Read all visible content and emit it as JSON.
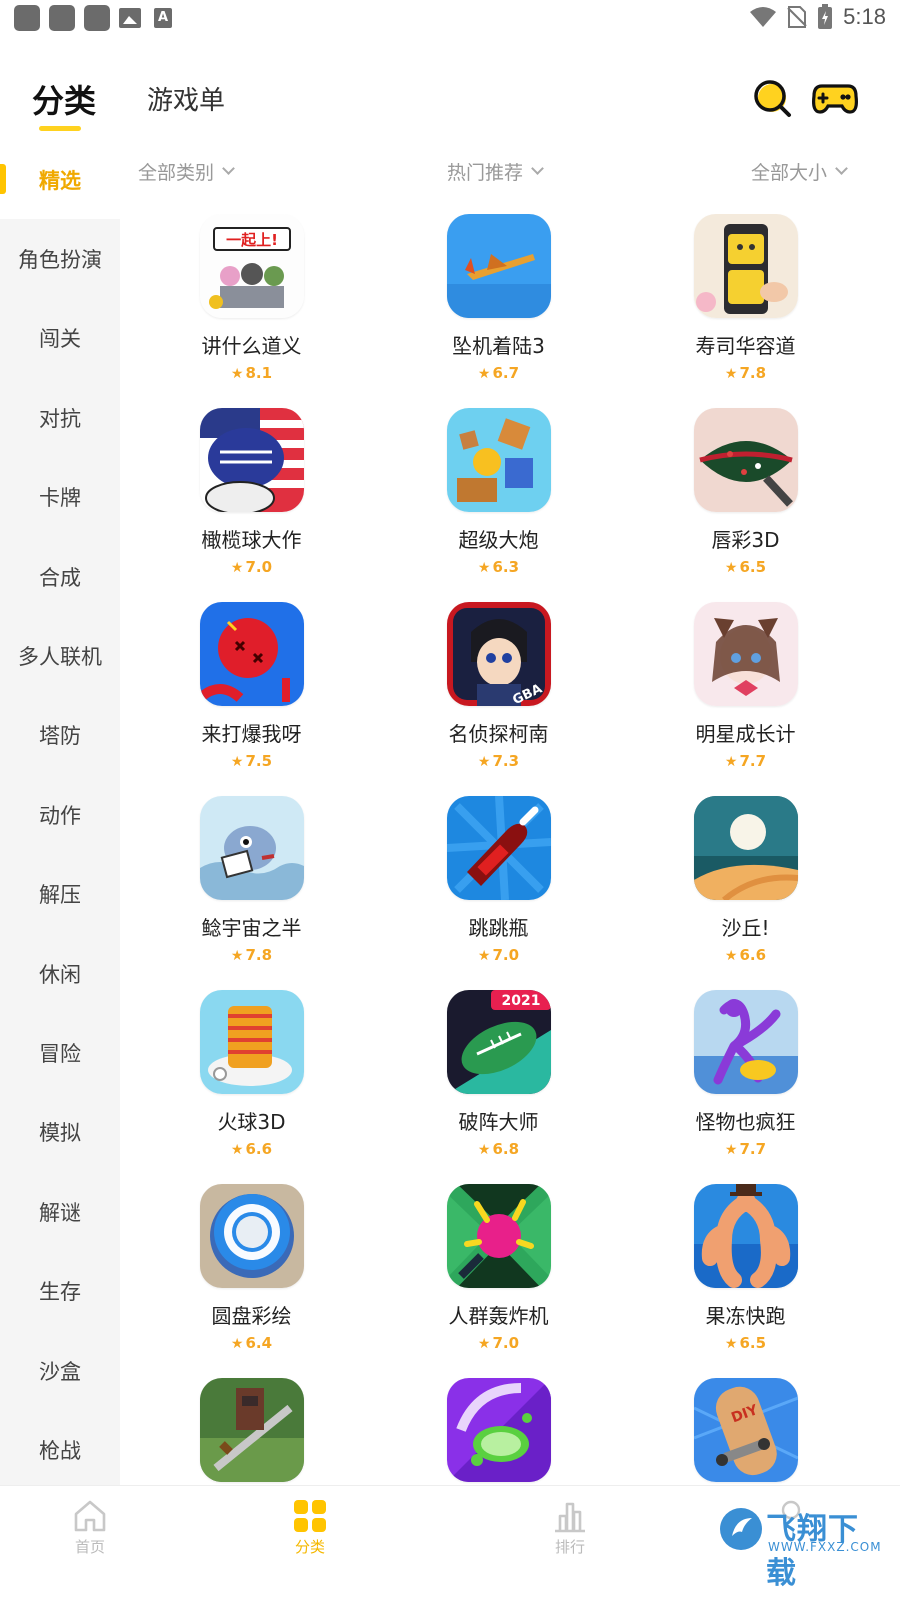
{
  "status_bar": {
    "time": "5:18",
    "icons": [
      "notification-icon",
      "notification-icon",
      "notification-icon",
      "image-icon",
      "font-icon",
      "wifi-icon",
      "no-sim-icon",
      "battery-icon"
    ]
  },
  "header": {
    "tabs": [
      {
        "label": "分类",
        "active": true
      },
      {
        "label": "游戏单",
        "active": false
      }
    ],
    "icons": [
      "search-icon",
      "gamepad-icon"
    ],
    "accent_color": "#FFD21F"
  },
  "sidebar": {
    "items": [
      {
        "label": "精选",
        "active": true
      },
      {
        "label": "角色扮演"
      },
      {
        "label": "闯关"
      },
      {
        "label": "对抗"
      },
      {
        "label": "卡牌"
      },
      {
        "label": "合成"
      },
      {
        "label": "多人联机"
      },
      {
        "label": "塔防"
      },
      {
        "label": "动作"
      },
      {
        "label": "解压"
      },
      {
        "label": "休闲"
      },
      {
        "label": "冒险"
      },
      {
        "label": "模拟"
      },
      {
        "label": "解谜"
      },
      {
        "label": "生存"
      },
      {
        "label": "沙盒"
      },
      {
        "label": "枪战"
      }
    ]
  },
  "filters": [
    {
      "label": "全部类别"
    },
    {
      "label": "热门推荐"
    },
    {
      "label": "全部大小"
    }
  ],
  "games": [
    {
      "name": "讲什么道义",
      "score": "8.1"
    },
    {
      "name": "坠机着陆3",
      "score": "6.7"
    },
    {
      "name": "寿司华容道",
      "score": "7.8"
    },
    {
      "name": "橄榄球大作",
      "score": "7.0"
    },
    {
      "name": "超级大炮",
      "score": "6.3"
    },
    {
      "name": "唇彩3D",
      "score": "6.5"
    },
    {
      "name": "来打爆我呀",
      "score": "7.5"
    },
    {
      "name": "名侦探柯南",
      "score": "7.3"
    },
    {
      "name": "明星成长计",
      "score": "7.7"
    },
    {
      "name": "鲶宇宙之半",
      "score": "7.8"
    },
    {
      "name": "跳跳瓶",
      "score": "7.0"
    },
    {
      "name": "沙丘!",
      "score": "6.6"
    },
    {
      "name": "火球3D",
      "score": "6.6"
    },
    {
      "name": "破阵大师",
      "score": "6.8"
    },
    {
      "name": "怪物也疯狂",
      "score": "7.7"
    },
    {
      "name": "圆盘彩绘",
      "score": "6.4"
    },
    {
      "name": "人群轰炸机",
      "score": "7.0"
    },
    {
      "name": "果冻快跑",
      "score": "6.5"
    },
    {
      "name": "",
      "score": ""
    },
    {
      "name": "",
      "score": ""
    },
    {
      "name": "",
      "score": ""
    }
  ],
  "icon_texts": {
    "banner_1": "一起上!",
    "badge_gba": "GBA",
    "badge_2021": "2021",
    "badge_diy": "DIY"
  },
  "bottom_nav": [
    {
      "label": "首页",
      "icon": "home-icon",
      "active": false
    },
    {
      "label": "分类",
      "icon": "category-grid-icon",
      "active": true
    },
    {
      "label": "排行",
      "icon": "ranking-icon",
      "active": false
    }
  ],
  "watermark": {
    "title": "飞翔下载",
    "url": "WWW.FXXZ.COM"
  },
  "score_color": "#F5A623"
}
